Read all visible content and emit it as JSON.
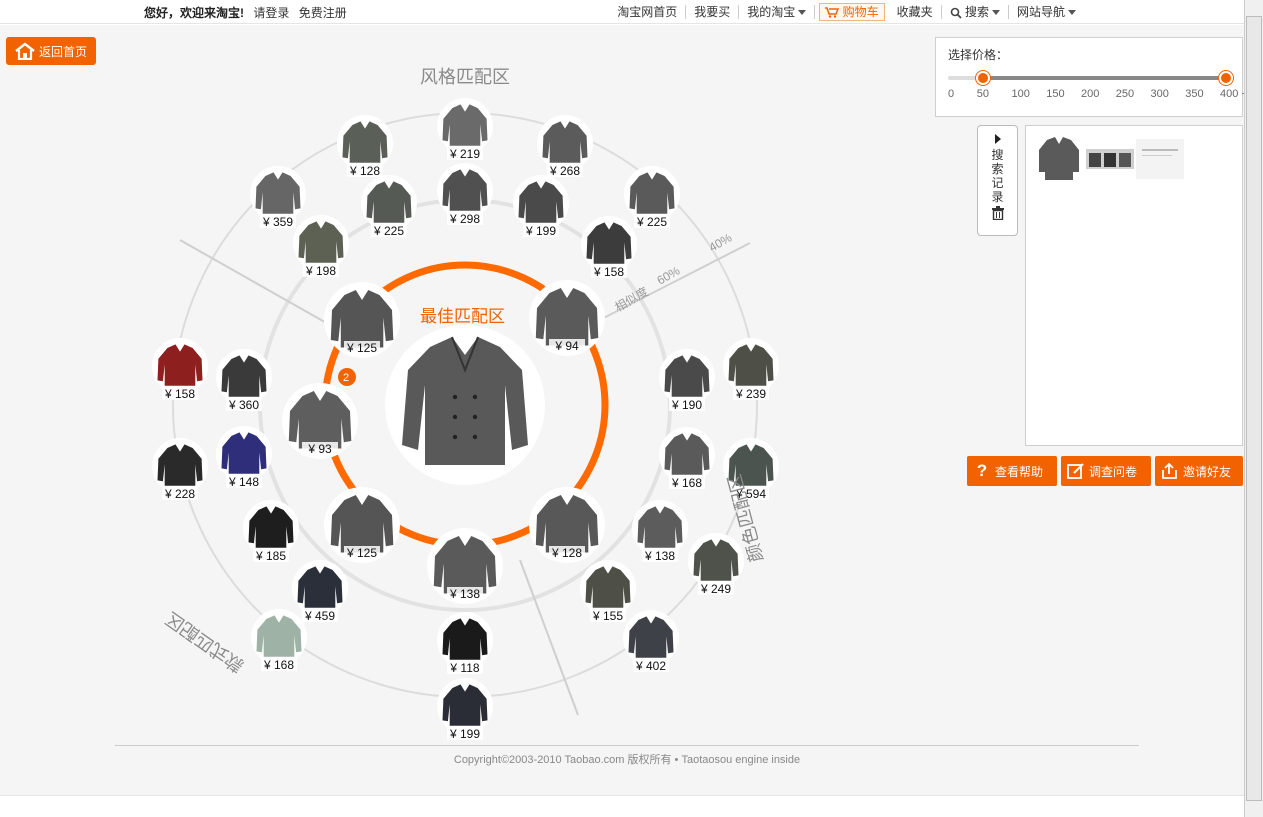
{
  "topbar": {
    "greeting": "您好，欢迎来淘宝!",
    "login": "请登录",
    "register": "免费注册",
    "nav": [
      {
        "label": "淘宝网首页",
        "caret": false
      },
      {
        "label": "我要买",
        "caret": false
      },
      {
        "label": "我的淘宝",
        "caret": true
      },
      {
        "label": "购物车",
        "caret": false
      },
      {
        "label": "收藏夹",
        "caret": false
      },
      {
        "label": "搜索",
        "caret": true
      },
      {
        "label": "网站导航",
        "caret": true
      }
    ]
  },
  "home_button": "返回首页",
  "zones": {
    "style": "风格匹配区",
    "best": "最佳匹配区",
    "color": "颜色匹配区",
    "shape": "款式匹配区",
    "similarity_label": "相似度",
    "sim_60": "60%",
    "sim_40": "40%"
  },
  "center_product": {
    "name": "center-jacket"
  },
  "best_badge": "2",
  "products": [
    {
      "price": "¥ 219",
      "ring": "style",
      "color": "#6a6a6a"
    },
    {
      "price": "¥ 128",
      "ring": "style",
      "color": "#5a6058"
    },
    {
      "price": "¥ 268",
      "ring": "style",
      "color": "#5b5b5b"
    },
    {
      "price": "¥ 298",
      "ring": "style",
      "color": "#505050"
    },
    {
      "price": "¥ 359",
      "ring": "style",
      "color": "#666666"
    },
    {
      "price": "¥ 225",
      "ring": "style",
      "color": "#555a55"
    },
    {
      "price": "¥ 199",
      "ring": "style",
      "color": "#4a4a4a"
    },
    {
      "price": "¥ 225",
      "ring": "style",
      "color": "#5a5a5a"
    },
    {
      "price": "¥ 198",
      "ring": "style",
      "color": "#5c6154"
    },
    {
      "price": "¥ 158",
      "ring": "style",
      "color": "#3c3c3c"
    },
    {
      "price": "¥ 125",
      "ring": "best",
      "color": "#555555"
    },
    {
      "price": "¥ 94",
      "ring": "best",
      "color": "#5a5a5a"
    },
    {
      "price": "¥ 93",
      "ring": "best",
      "color": "#5e5e5e"
    },
    {
      "price": "¥ 125",
      "ring": "best",
      "color": "#555555"
    },
    {
      "price": "¥ 128",
      "ring": "best",
      "color": "#585858"
    },
    {
      "price": "¥ 138",
      "ring": "best",
      "color": "#5a5a5a"
    },
    {
      "price": "¥ 158",
      "ring": "shape",
      "color": "#8e1f1f"
    },
    {
      "price": "¥ 360",
      "ring": "shape",
      "color": "#3a3a3a"
    },
    {
      "price": "¥ 228",
      "ring": "shape",
      "color": "#2a2a2a"
    },
    {
      "price": "¥ 148",
      "ring": "shape",
      "color": "#2e2e7a"
    },
    {
      "price": "¥ 185",
      "ring": "shape",
      "color": "#1e1e1e"
    },
    {
      "price": "¥ 459",
      "ring": "shape",
      "color": "#2a2f3a"
    },
    {
      "price": "¥ 168",
      "ring": "shape",
      "color": "#9eb3a5"
    },
    {
      "price": "¥ 118",
      "ring": "shape",
      "color": "#1a1a1a"
    },
    {
      "price": "¥ 199",
      "ring": "shape",
      "color": "#2a2d36"
    },
    {
      "price": "¥ 190",
      "ring": "color",
      "color": "#4a4a4a"
    },
    {
      "price": "¥ 239",
      "ring": "color",
      "color": "#4e5048"
    },
    {
      "price": "¥ 168",
      "ring": "color",
      "color": "#5a5a5a"
    },
    {
      "price": "¥ 594",
      "ring": "color",
      "color": "#4c5450"
    },
    {
      "price": "¥ 138",
      "ring": "color",
      "color": "#5c5c5c"
    },
    {
      "price": "¥ 249",
      "ring": "color",
      "color": "#4e524a"
    },
    {
      "price": "¥ 155",
      "ring": "color",
      "color": "#4e5048"
    },
    {
      "price": "¥ 402",
      "ring": "color",
      "color": "#3e4248"
    }
  ],
  "price_panel": {
    "title": "选择价格：",
    "ticks": [
      "0",
      "50",
      "100",
      "150",
      "200",
      "250",
      "300",
      "350",
      "400 +"
    ],
    "low": 50,
    "high": 400
  },
  "history": {
    "toggle_label": [
      "搜",
      "索",
      "记",
      "录"
    ]
  },
  "actions": {
    "help": "查看帮助",
    "survey": "调查问卷",
    "invite": "邀请好友"
  },
  "footer": {
    "copyright": "Copyright©2003-2010 Taobao.com  版权所有 • Taotaosou engine inside"
  },
  "colors": {
    "accent": "#f26300",
    "ring": "#ff6a00"
  }
}
